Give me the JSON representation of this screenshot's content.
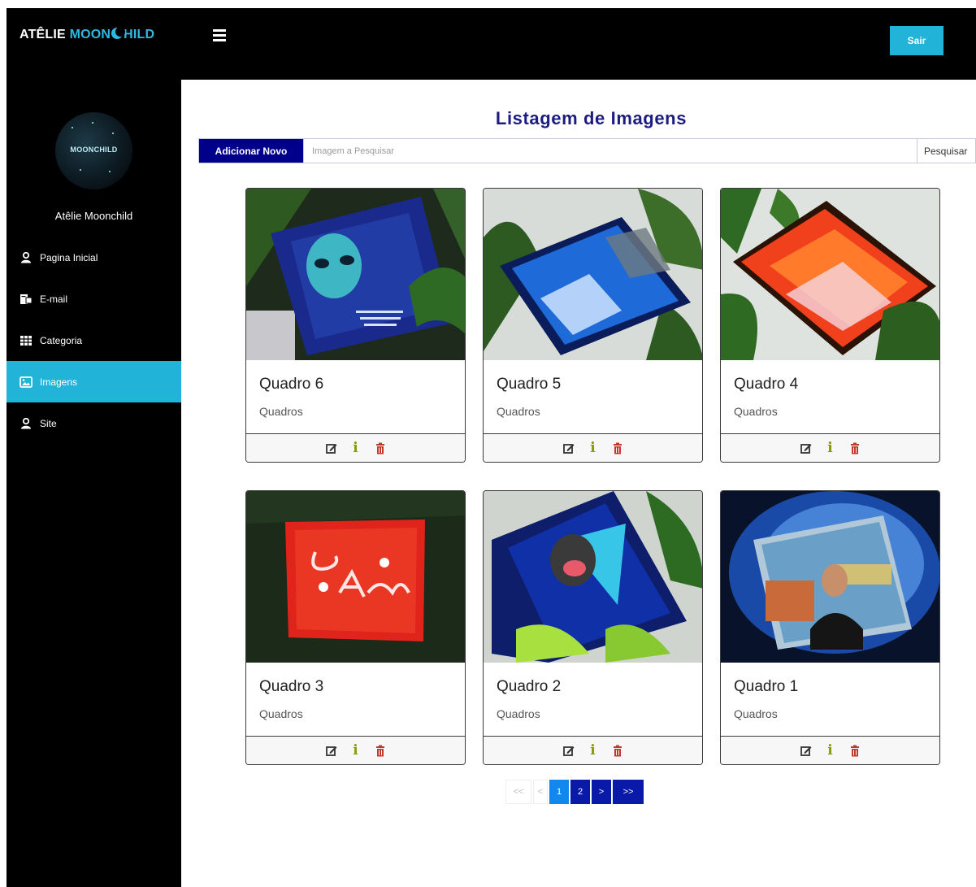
{
  "header": {
    "brand_part1": "ATÊLIE ",
    "brand_part2": "MOON",
    "brand_part3": "HILD",
    "logout_label": "Sair"
  },
  "sidebar": {
    "avatar_text": "MOONCHILD",
    "name": "Atêlie Moonchild",
    "items": [
      {
        "label": "Pagina Inicial",
        "icon": "user-icon",
        "active": false
      },
      {
        "label": "E-mail",
        "icon": "email-icon",
        "active": false
      },
      {
        "label": "Categoria",
        "icon": "table-icon",
        "active": false
      },
      {
        "label": "Imagens",
        "icon": "image-icon",
        "active": true
      },
      {
        "label": "Site",
        "icon": "user-icon",
        "active": false
      }
    ]
  },
  "main": {
    "title": "Listagem de Imagens",
    "add_label": "Adicionar Novo",
    "search_placeholder": "Imagem a Pesquisar",
    "search_label": "Pesquisar",
    "cards": [
      {
        "title": "Quadro 6",
        "category": "Quadros",
        "image": "alien painting"
      },
      {
        "title": "Quadro 5",
        "category": "Quadros",
        "image": "blue sky painting"
      },
      {
        "title": "Quadro 4",
        "category": "Quadros",
        "image": "red orange painting"
      },
      {
        "title": "Quadro 3",
        "category": "Quadros",
        "image": "red lettering painting"
      },
      {
        "title": "Quadro 2",
        "category": "Quadros",
        "image": "dog triangle painting"
      },
      {
        "title": "Quadro 1",
        "category": "Quadros",
        "image": "portrait painting"
      }
    ],
    "actions": {
      "edit": "edit-icon",
      "info": "i",
      "delete": "trash-icon"
    },
    "pagination": [
      "<<",
      "<",
      "1",
      "2",
      ">",
      ">>"
    ],
    "current_page": "1"
  },
  "colors": {
    "accent": "#21b4d8",
    "title": "#1c1c80",
    "add_button": "#00008b",
    "page_current": "#1188ee",
    "page_normal": "#0a1aa8",
    "info": "#8a9a00",
    "delete": "#c0392b"
  }
}
